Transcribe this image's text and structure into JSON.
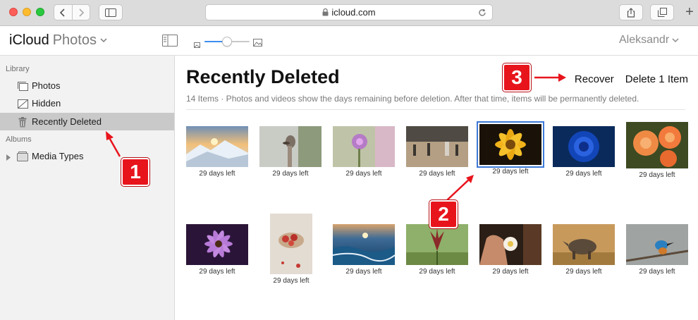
{
  "browser": {
    "url": "icloud.com"
  },
  "app": {
    "brand_primary": "iCloud",
    "brand_secondary": "Photos",
    "user_name": "Aleksandr",
    "zoom_level": 0.5
  },
  "sidebar": {
    "library_heading": "Library",
    "library_items": [
      {
        "label": "Photos",
        "icon": "photos-icon"
      },
      {
        "label": "Hidden",
        "icon": "hidden-icon"
      },
      {
        "label": "Recently Deleted",
        "icon": "trash-icon"
      }
    ],
    "albums_heading": "Albums",
    "albums_items": [
      {
        "label": "Media Types",
        "icon": "folder-icon"
      }
    ]
  },
  "main": {
    "title": "Recently Deleted",
    "subtitle": "14 Items  ·  Photos and videos show the days remaining before deletion. After that time, items will be permanently deleted.",
    "recover_label": "Recover",
    "delete_label": "Delete 1 Item",
    "photos": [
      {
        "days": "29 days left",
        "subject": "snowy mountain sunset"
      },
      {
        "days": "29 days left",
        "subject": "ostrich"
      },
      {
        "days": "29 days left",
        "subject": "purple thistle flower"
      },
      {
        "days": "29 days left",
        "subject": "deer in field"
      },
      {
        "days": "29 days left",
        "subject": "yellow flower",
        "selected": true
      },
      {
        "days": "29 days left",
        "subject": "blue rose"
      },
      {
        "days": "29 days left",
        "subject": "orange roses"
      },
      {
        "days": "29 days left",
        "subject": "purple daisy"
      },
      {
        "days": "29 days left",
        "subject": "strawberries"
      },
      {
        "days": "29 days left",
        "subject": "ocean rocks sunset"
      },
      {
        "days": "29 days left",
        "subject": "spiky flower bud"
      },
      {
        "days": "29 days left",
        "subject": "hand with white flower"
      },
      {
        "days": "29 days left",
        "subject": "rhino"
      },
      {
        "days": "29 days left",
        "subject": "kingfisher bird"
      }
    ]
  },
  "annotations": {
    "badge_1": "1",
    "badge_2": "2",
    "badge_3": "3"
  },
  "colors": {
    "accent": "#3d8ef0",
    "selection_outline": "#3d79d6",
    "badge_red": "#e8141c"
  }
}
